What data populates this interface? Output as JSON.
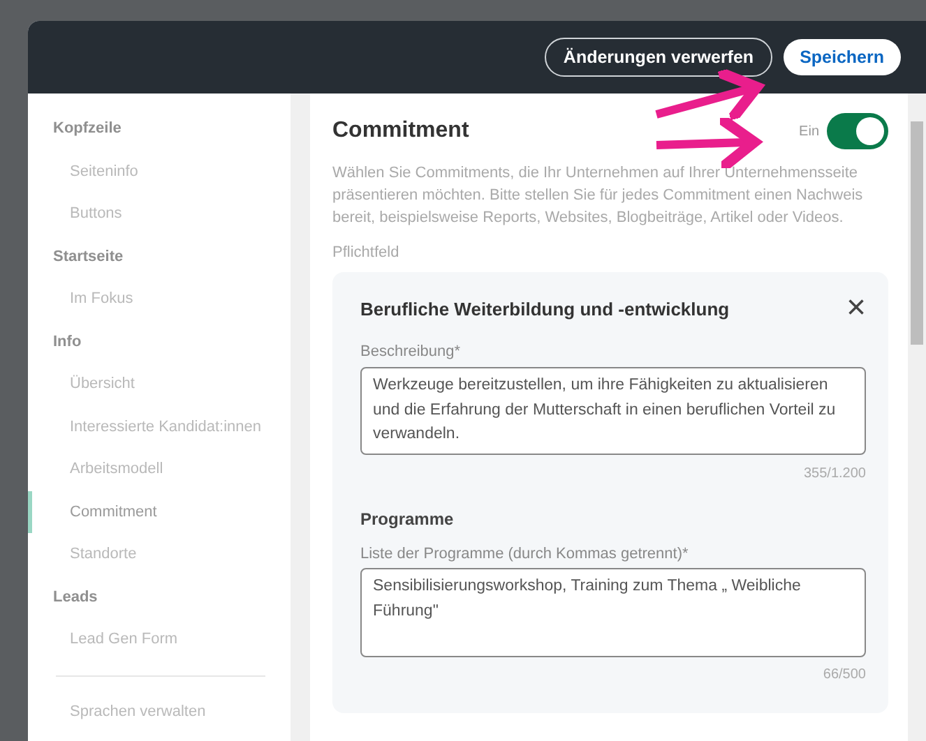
{
  "header": {
    "buttons": [
      {
        "label": "Änderungen verwerfen",
        "kind": "outline"
      },
      {
        "label": "Speichern",
        "kind": "primary"
      }
    ]
  },
  "sidebar": {
    "items": [
      {
        "label": "Kopfzeile",
        "kind": "heading"
      },
      {
        "label": "Seiteninfo",
        "kind": "item",
        "selected": false
      },
      {
        "label": "Buttons",
        "kind": "item",
        "selected": false
      },
      {
        "label": "Startseite",
        "kind": "heading"
      },
      {
        "label": "Im Fokus",
        "kind": "item",
        "selected": false
      },
      {
        "label": "Info",
        "kind": "heading"
      },
      {
        "label": "Übersicht",
        "kind": "item",
        "selected": false
      },
      {
        "label": "Interessierte Kandidat:innen",
        "kind": "item",
        "selected": false
      },
      {
        "label": "Arbeitsmodell",
        "kind": "item",
        "selected": false
      },
      {
        "label": "Commitment",
        "kind": "item",
        "selected": true
      },
      {
        "label": "Standorte",
        "kind": "item",
        "selected": false
      },
      {
        "label": "Leads",
        "kind": "heading"
      },
      {
        "label": "Lead Gen Form",
        "kind": "item",
        "selected": false
      },
      {
        "kind": "divider"
      },
      {
        "label": "Sprachen verwalten",
        "kind": "item",
        "selected": false
      }
    ]
  },
  "main": {
    "title": "Commitment",
    "toggle": {
      "label": "Ein",
      "on": true
    },
    "description": "Wählen Sie Commitments, die Ihr Unternehmen auf Ihrer Unternehmensseite präsentieren möchten. Bitte stellen Sie für jedes Commitment einen Nachweis bereit, beispielsweise Reports, Websites, Blogbeiträge, Artikel oder Videos.",
    "required_note": "Pflichtfeld",
    "card": {
      "title": "Berufliche Weiterbildung und -entwicklung",
      "close": "×",
      "fields": [
        {
          "label": "Beschreibung*",
          "value": "Werkzeuge bereitzustellen, um ihre Fähigkeiten zu aktualisieren und die Erfahrung der Mutterschaft in einen beruflichen Vorteil zu verwandeln.",
          "counter": "355/1.200"
        },
        {
          "section": "Programme",
          "label": "Liste der Programme (durch Kommas getrennt)*",
          "value": "Sensibilisierungsworkshop, Training zum Thema „ Weibliche Führung\"",
          "counter": "66/500"
        }
      ]
    }
  }
}
